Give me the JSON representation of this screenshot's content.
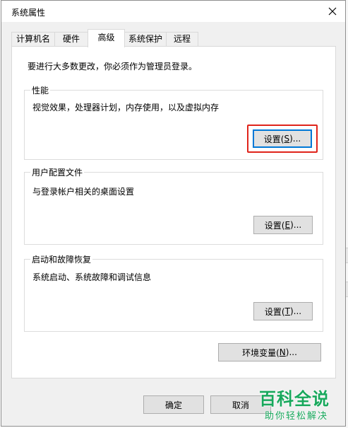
{
  "window": {
    "title": "系统属性"
  },
  "tabs": [
    {
      "label": "计算机名",
      "active": false
    },
    {
      "label": "硬件",
      "active": false
    },
    {
      "label": "高级",
      "active": true
    },
    {
      "label": "系统保护",
      "active": false
    },
    {
      "label": "远程",
      "active": false
    }
  ],
  "intro": "要进行大多数更改，你必须作为管理员登录。",
  "groups": {
    "performance": {
      "title": "性能",
      "desc": "视觉效果，处理器计划，内存使用，以及虚拟内存",
      "button": {
        "pre": "设置(",
        "key": "S",
        "post": ")..."
      }
    },
    "profile": {
      "title": "用户配置文件",
      "desc": "与登录帐户相关的桌面设置",
      "button": {
        "pre": "设置(",
        "key": "E",
        "post": ")..."
      }
    },
    "startup": {
      "title": "启动和故障恢复",
      "desc": "系统启动、系统故障和调试信息",
      "button": {
        "pre": "设置(",
        "key": "T",
        "post": ")..."
      }
    }
  },
  "env_button": {
    "pre": "环境变量(",
    "key": "N",
    "post": ")..."
  },
  "footer": {
    "ok": "确定",
    "cancel": "取消"
  },
  "watermark": {
    "title": "百科全说",
    "subtitle": "助你轻松解决"
  },
  "colors": {
    "highlight": "#e0241b",
    "watermark": "#18a85c",
    "focus": "#0078d7"
  }
}
